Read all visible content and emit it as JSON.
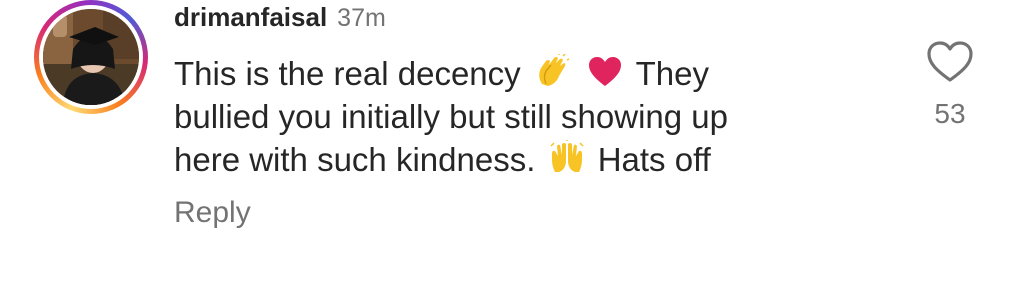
{
  "comment": {
    "username": "drimanfaisal",
    "time": "37m",
    "lines": [
      {
        "before": "This is the real decency",
        "after": "They"
      },
      {
        "text": "bullied you initially but still showing up"
      },
      {
        "before": "here with such kindness.",
        "after": "Hats off"
      }
    ],
    "emojis": {
      "clap": "clapping-hands",
      "heart": "red-heart",
      "raised": "raising-hands"
    },
    "reply_label": "Reply",
    "like_count": "53",
    "colors": {
      "text": "#262626",
      "muted": "#737373",
      "heart_emoji": "#e0245e",
      "hand_emoji": "#f7c325"
    }
  }
}
